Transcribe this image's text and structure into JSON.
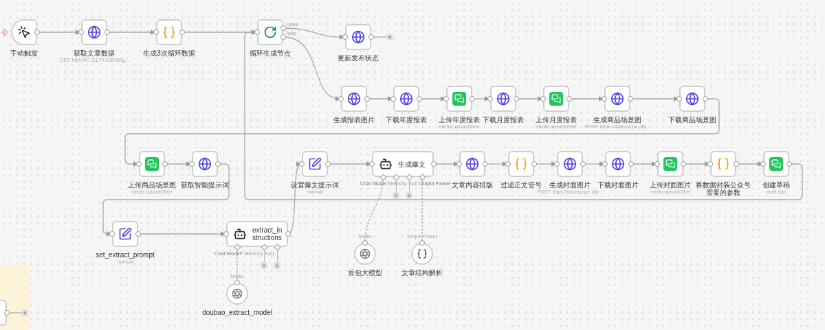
{
  "nodes": [
    {
      "kind": "trigger",
      "title": "手动触发"
    },
    {
      "kind": "http",
      "title": "获取文章数据",
      "subtitle": "GET: http://47.111.74.208:80/g..."
    },
    {
      "kind": "code",
      "title": "生成3次循环数据"
    },
    {
      "kind": "loop",
      "title": "循环生成节点",
      "outputs": [
        "done",
        "loop"
      ]
    },
    {
      "kind": "http",
      "title": "更新发布状态",
      "open_output": true
    },
    {
      "kind": "http",
      "title": "生成报表图片"
    },
    {
      "kind": "http",
      "title": "下载年度报表"
    },
    {
      "kind": "wechat",
      "title": "上传年度报表",
      "subtitle": "media:uploadOther"
    },
    {
      "kind": "http",
      "title": "下载月度报表"
    },
    {
      "kind": "wechat",
      "title": "上传月度报表",
      "subtitle": "media:uploadOther"
    },
    {
      "kind": "http",
      "title": "生成商品场景图",
      "subtitle": "POST: https://dashscope.aliy..."
    },
    {
      "kind": "http",
      "title": "下载商品场景图"
    },
    {
      "kind": "wechat",
      "title": "上传商品场景图",
      "subtitle": "media:uploadOther"
    },
    {
      "kind": "http",
      "title": "获取智能提示词"
    },
    {
      "kind": "set",
      "title": "设置爆文提示词",
      "subtitle": "manual"
    },
    {
      "kind": "agent",
      "title": "生成爆文",
      "ports": [
        {
          "label": "Chat Model",
          "connected": true
        },
        {
          "label": "Memory",
          "connected": false
        },
        {
          "label": "Tool",
          "connected": false
        },
        {
          "label": "Output Parser",
          "connected": true
        }
      ]
    },
    {
      "kind": "http",
      "title": "文章内容排版"
    },
    {
      "kind": "code",
      "title": "过滤正文管号"
    },
    {
      "kind": "http",
      "title": "生成封面图片",
      "subtitle": "POST: https://dashscope.aliy..."
    },
    {
      "kind": "http",
      "title": "下载封面图片"
    },
    {
      "kind": "wechat",
      "title": "上传封面图片",
      "subtitle": "media:uploadOther"
    },
    {
      "kind": "code",
      "title": "将数据封装公众号需要的参数"
    },
    {
      "kind": "wechat",
      "title": "创建草稿",
      "subtitle": "draft:add"
    },
    {
      "kind": "set",
      "title": "set_extract_prompt",
      "subtitle": "manual"
    },
    {
      "kind": "agent",
      "title": "extract_instructions",
      "ports": [
        {
          "label": "Chat Model*",
          "connected": true
        },
        {
          "label": "Memory",
          "connected": false
        },
        {
          "label": "Tool",
          "connected": false
        }
      ]
    },
    {
      "kind": "model",
      "title": "豆包大模型",
      "input_label": "Model"
    },
    {
      "kind": "parser",
      "title": "文章结构解析",
      "input_label": "Output Parser"
    },
    {
      "kind": "model",
      "title": "doubao_extract_model",
      "input_label": "Model"
    }
  ]
}
